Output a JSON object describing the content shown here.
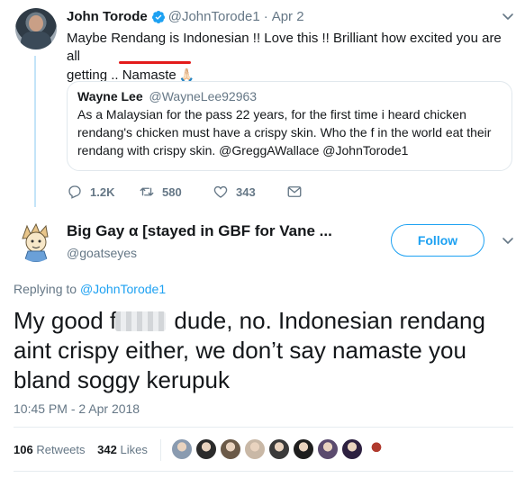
{
  "parent_tweet": {
    "name": "John Torode",
    "handle": "@JohnTorode1",
    "date": "Apr 2",
    "text_line1": "Maybe Rendang is Indonesian !!   Love this !! Brilliant how excited you are all",
    "text_line2_prefix": "getting .. ",
    "text_line2_word": "Namaste",
    "emoji": "🙏🏻",
    "quote": {
      "name": "Wayne Lee",
      "handle": "@WayneLee92963",
      "text": "As a Malaysian for the pass 22 years, for the first time i heard chicken rendang's chicken must have a crispy skin. Who the f in the world eat their rendang with crispy skin. @GreggAWallace @JohnTorode1"
    },
    "actions": {
      "reply_count": "",
      "retweet_count": "580",
      "like_count": "343",
      "reply_display": "1.2K"
    }
  },
  "reply_tweet": {
    "name": "Big Gay α [stayed in GBF for Vane ...",
    "handle": "@goatseyes",
    "follow_label": "Follow",
    "replying_prefix": "Replying to ",
    "replying_to": "@JohnTorode1",
    "text_part1": "My good f",
    "text_part2": " dude, no. Indonesian rendang aint crispy either, we don’t say namaste you bland soggy kerupuk",
    "timestamp": "10:45 PM - 2 Apr 2018",
    "retweets_count": "106",
    "retweets_label": "Retweets",
    "likes_count": "342",
    "likes_label": "Likes"
  },
  "colors": {
    "accent": "#1da1f2",
    "muted": "#657786",
    "underline": "#e31b1b"
  },
  "liker_colors": [
    "#8a9bb0",
    "#2b2b2b",
    "#6b5a48",
    "#c9b8a6",
    "#3a3a3a",
    "#1e1e1e",
    "#5b4b6e",
    "#2d2040",
    "#b03a2e"
  ]
}
